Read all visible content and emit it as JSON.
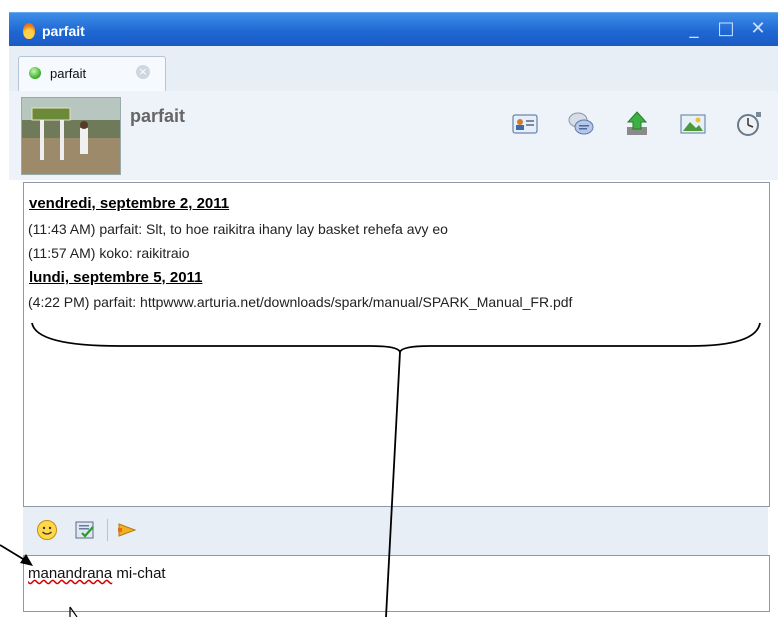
{
  "window": {
    "title": "parfait",
    "accent": "#1f67d3"
  },
  "tab": {
    "label": "parfait",
    "status": "online"
  },
  "contact": {
    "name": "parfait"
  },
  "toolbar_icons": [
    "contact-card-icon",
    "chat-bubbles-icon",
    "send-file-icon",
    "picture-icon",
    "stopwatch-icon"
  ],
  "chat": {
    "days": [
      {
        "date": "vendredi, septembre 2, 2011",
        "messages": [
          {
            "text": "(11:43 AM) parfait: Slt, to hoe raikitra ihany lay basket rehefa avy eo"
          },
          {
            "text": "(11:57 AM) koko: raikitraio"
          }
        ]
      },
      {
        "date": "lundi, septembre 5, 2011",
        "messages": [
          {
            "text": "(4:22 PM) parfait: httpwww.arturia.net/downloads/spark/manual/SPARK_Manual_FR.pdf"
          }
        ]
      }
    ]
  },
  "input": {
    "misspelled_word": "manandrana",
    "rest_text": " mi-chat"
  }
}
